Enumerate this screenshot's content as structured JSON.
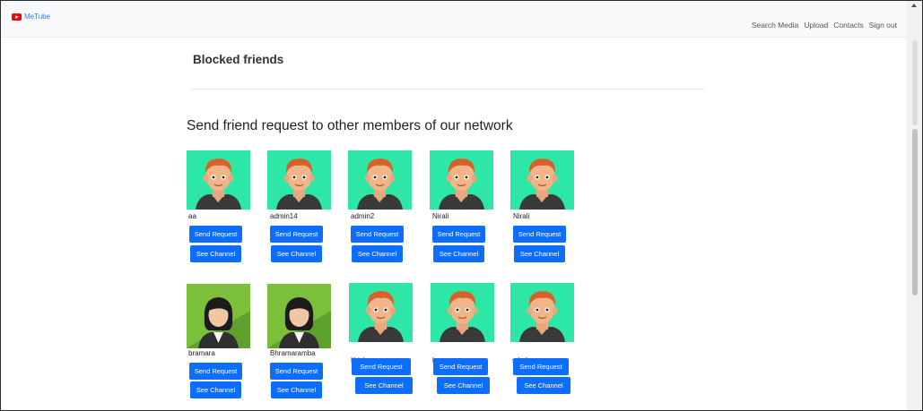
{
  "nav": {
    "brand": "MeTube",
    "links": [
      "Search Media",
      "Upload",
      "Contacts",
      "Sign out"
    ]
  },
  "blocked": {
    "title": "Blocked friends"
  },
  "network": {
    "title": "Send friend request to other members of our network",
    "send_label": "Send Request",
    "channel_label": "See Channel",
    "members": [
      {
        "name": "aa",
        "avatar": "male-avatar-icon"
      },
      {
        "name": "admin14",
        "avatar": "male-avatar-icon"
      },
      {
        "name": "admin2",
        "avatar": "male-avatar-icon"
      },
      {
        "name": "Nirali",
        "avatar": "male-avatar-icon"
      },
      {
        "name": "Nirali",
        "avatar": "male-avatar-icon"
      },
      {
        "name": "bramara",
        "avatar": "female-avatar-icon"
      },
      {
        "name": "Bhramaramba",
        "avatar": "female-avatar-icon"
      },
      {
        "name": "Krishna",
        "avatar": "male-avatar-icon"
      },
      {
        "name": "bramara",
        "avatar": "male-avatar-icon"
      },
      {
        "name": "sdcd",
        "avatar": "male-avatar-icon"
      }
    ]
  },
  "colors": {
    "primary": "#0d6efd",
    "male_bg": "#2ee6a6",
    "female_bg": "#7bbf3a"
  }
}
